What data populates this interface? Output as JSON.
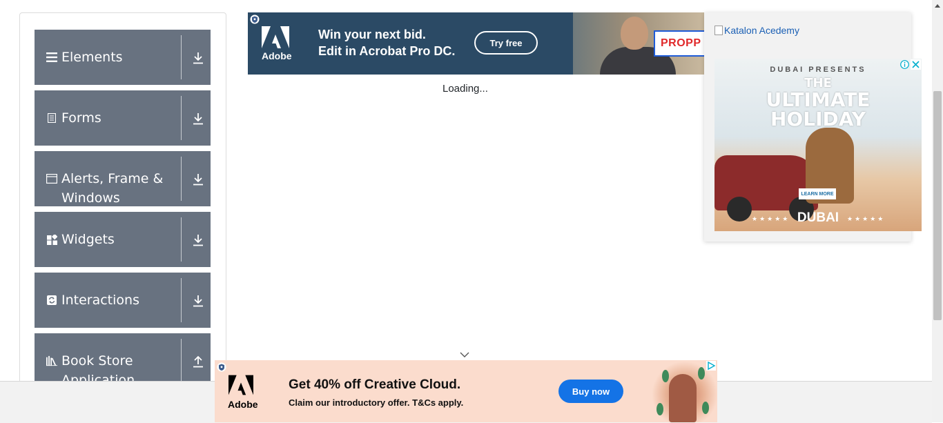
{
  "sidebar": {
    "groups": [
      {
        "label": "Elements",
        "icon": "hamburger-icon",
        "toggle": "download-arrow-icon"
      },
      {
        "label": "Forms",
        "icon": "document-icon",
        "toggle": "download-arrow-icon"
      },
      {
        "label": "Alerts, Frame & Windows",
        "icon": "browser-window-icon",
        "toggle": "download-arrow-icon"
      },
      {
        "label": "Widgets",
        "icon": "widgets-grid-icon",
        "toggle": "download-arrow-icon"
      },
      {
        "label": "Interactions",
        "icon": "interaction-cycle-icon",
        "toggle": "download-arrow-icon"
      },
      {
        "label": "Book Store Application",
        "icon": "books-icon",
        "toggle": "upload-arrow-icon"
      }
    ],
    "colors": {
      "group_bg": "#687280",
      "text": "#ffffff"
    }
  },
  "top_ad": {
    "brand": "Adobe",
    "headline_line1": "Win your next bid.",
    "headline_line2": "Edit in Acrobat Pro DC.",
    "cta": "Try free",
    "card_text": "PROPP",
    "colors": {
      "bg": "#2b4a65",
      "card_border": "#1e5bd7",
      "card_text": "#e0282a"
    }
  },
  "main": {
    "loading_text": "Loading..."
  },
  "side_ad": {
    "broken_image_alt": "Katalon Acedemy",
    "dubai": {
      "presents": "DUBAI PRESENTS",
      "title_line1": "THE",
      "title_line2": "ULTIMATE",
      "title_line3": "HOLIDAY",
      "learn_more": "LEARN MORE",
      "stars_left": "★★★★★",
      "stars_right": "★★★★★",
      "logo": "DUBAI"
    },
    "icons": [
      "info-icon",
      "close-icon"
    ]
  },
  "bottom_ad": {
    "brand": "Adobe",
    "headline": "Get 40% off Creative Cloud.",
    "subline": "Claim our introductory offer. T&Cs apply.",
    "cta": "Buy now",
    "colors": {
      "bg": "#fbdccd",
      "cta_bg": "#1473e6"
    }
  }
}
